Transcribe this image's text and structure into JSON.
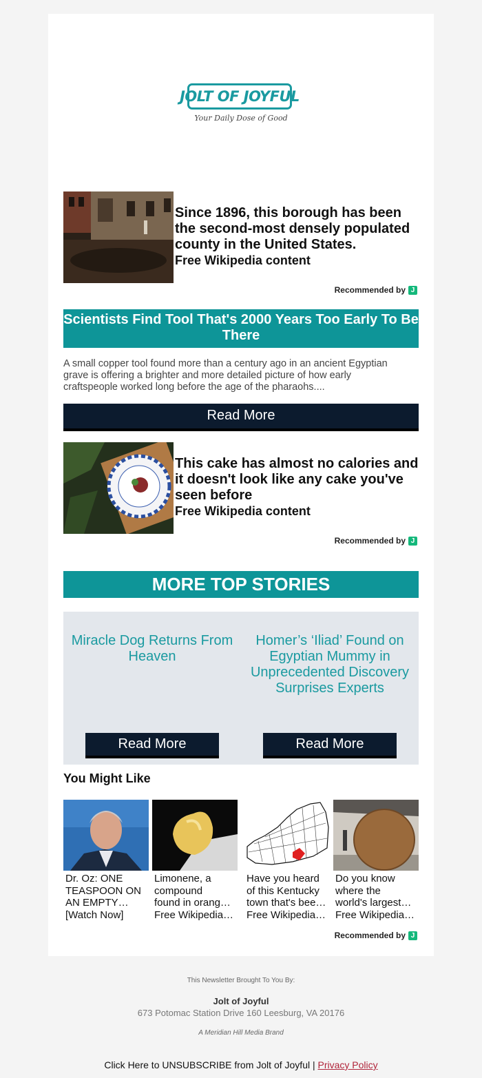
{
  "brand": {
    "logo_text": "JOLT OF JOYFUL",
    "tagline": "Your Daily Dose of Good",
    "accent": "#1a9aa0"
  },
  "promo1": {
    "headline": "Since 1896, this borough has been the second-most densely populated county in the United States.",
    "source": "Free Wikipedia content",
    "recommended": "Recommended by"
  },
  "article": {
    "title": "Scientists Find Tool That's 2000 Years Too Early To Be There",
    "body": "A small copper tool found more than a century ago in an ancient Egyptian grave is offering a brighter and more detailed picture of how early craftspeople worked long before the age of the pharaohs....",
    "button": "Read More"
  },
  "promo2": {
    "headline": "This cake has almost no calories and it doesn't look like any cake you've seen before",
    "source": "Free Wikipedia content",
    "recommended": "Recommended by"
  },
  "more_stories": {
    "header": "MORE TOP STORIES",
    "items": [
      {
        "title": "Miracle Dog Returns From Heaven",
        "button": "Read More"
      },
      {
        "title": "Homer’s ‘Iliad’ Found on Egyptian Mummy in Unprecedented Discovery Surprises Experts",
        "button": "Read More"
      }
    ]
  },
  "you_might_like": {
    "title": "You Might Like",
    "items": [
      {
        "lines": [
          "Dr. Oz: ONE",
          "TEASPOON ON",
          "AN EMPTY…",
          "[Watch Now]"
        ]
      },
      {
        "lines": [
          "Limonene, a",
          "compound",
          "found in orang…",
          "Free Wikipedia …"
        ]
      },
      {
        "lines": [
          "Have you heard",
          "of this Kentucky",
          "town that's bee…",
          "Free Wikipedia …"
        ]
      },
      {
        "lines": [
          "Do you know",
          "where the",
          "world's largest…",
          "Free Wikipedia …"
        ]
      }
    ],
    "recommended": "Recommended by"
  },
  "footer": {
    "brought_by": "This Newsletter Brought To You By:",
    "company": "Jolt of Joyful",
    "address": "673 Potomac Station Drive 160 Leesburg, VA 20176",
    "brand_note": "A Meridian Hill Media Brand",
    "unsubscribe": "Click Here to UNSUBSCRIBE from Jolt of Joyful |",
    "privacy": "Privacy Policy"
  }
}
